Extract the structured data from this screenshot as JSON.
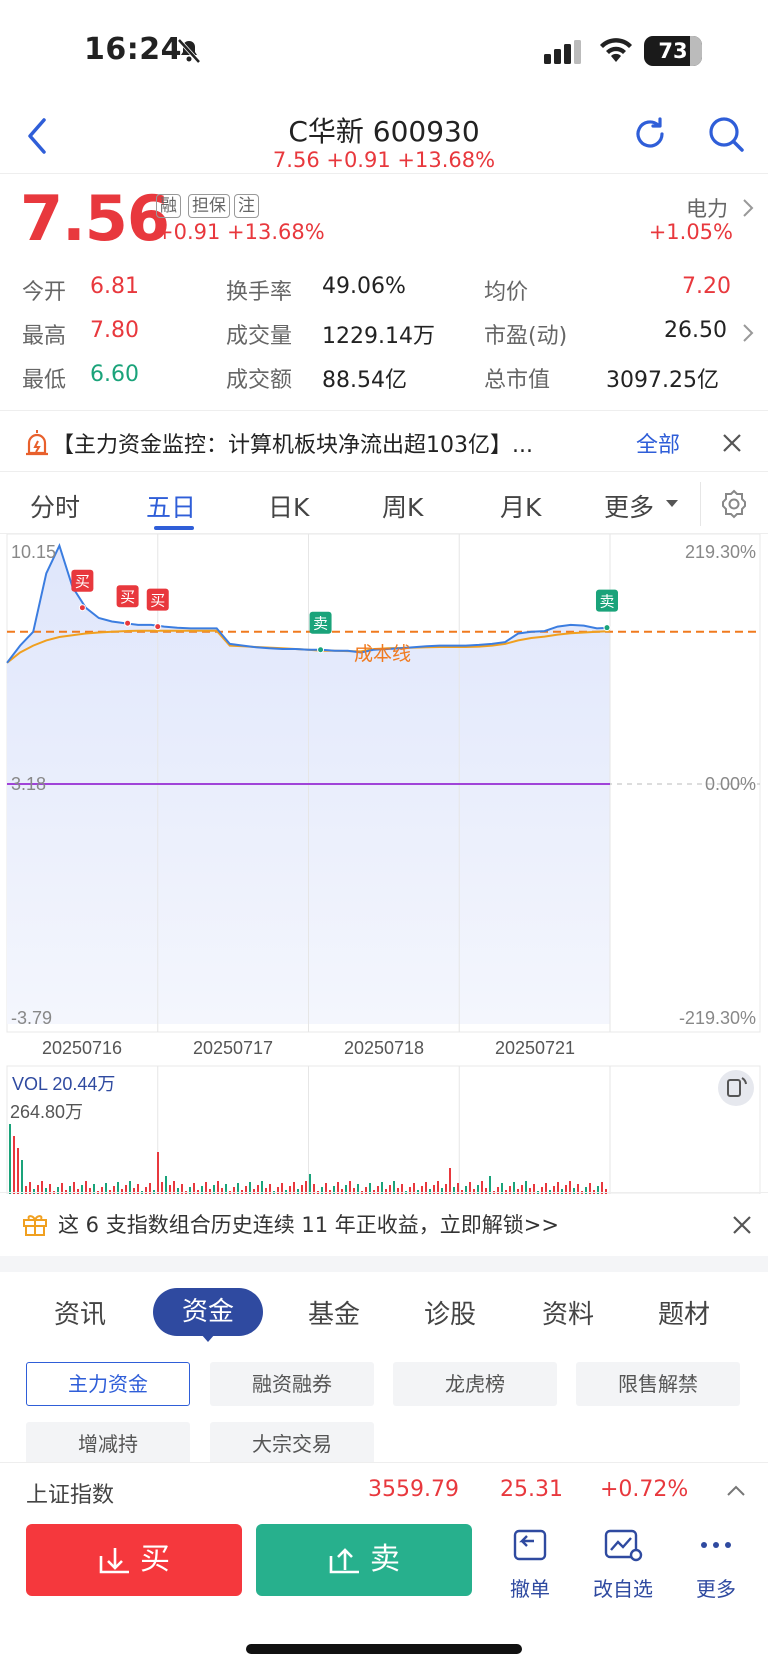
{
  "status_bar": {
    "time": "16:24",
    "battery": "73"
  },
  "header": {
    "title": "C华新 600930",
    "subtitle": "7.56 +0.91 +13.68%"
  },
  "quote": {
    "price": "7.56",
    "tags": [
      "融",
      "担保",
      "注"
    ],
    "change": "+0.91  +13.68%",
    "sector_name": "电力",
    "sector_change": "+1.05%"
  },
  "stats": [
    {
      "label": "今开",
      "value": "6.81",
      "color": "red"
    },
    {
      "label": "换手率",
      "value": "49.06%",
      "color": "black"
    },
    {
      "label": "均价",
      "value": "7.20",
      "color": "red"
    },
    {
      "label": "最高",
      "value": "7.80",
      "color": "red"
    },
    {
      "label": "成交量",
      "value": "1229.14万",
      "color": "black"
    },
    {
      "label": "市盈(动)",
      "value": "26.50",
      "color": "black"
    },
    {
      "label": "最低",
      "value": "6.60",
      "color": "green"
    },
    {
      "label": "成交额",
      "value": "88.54亿",
      "color": "black"
    },
    {
      "label": "总市值",
      "value": "3097.25亿",
      "color": "black"
    }
  ],
  "alert": {
    "text": "【主力资金监控：计算机板块净流出超103亿】...",
    "all_label": "全部"
  },
  "chart_tabs": [
    "分时",
    "五日",
    "日K",
    "周K",
    "月K",
    "更多"
  ],
  "chart_tab_active": "五日",
  "chart_data": {
    "type": "line",
    "y_left": {
      "top": "10.15",
      "mid": "3.18",
      "bottom": "-3.79"
    },
    "y_right": {
      "top": "219.30%",
      "mid": "0.00%",
      "bottom": "-219.30%"
    },
    "dates": [
      "20250716",
      "20250717",
      "20250718",
      "20250721"
    ],
    "cost_line_label": "成本线",
    "markers": [
      {
        "label": "买",
        "day": 0,
        "pos": 0.5
      },
      {
        "label": "买",
        "day": 0,
        "pos": 0.8
      },
      {
        "label": "买",
        "day": 1,
        "pos": 0.0
      },
      {
        "label": "卖",
        "day": 2,
        "pos": 0.08
      },
      {
        "label": "卖",
        "day": 3,
        "pos": 0.98
      }
    ],
    "price_series": [
      6.7,
      7.2,
      7.6,
      9.3,
      10.1,
      8.9,
      8.3,
      8.0,
      7.9,
      7.85,
      7.8,
      7.8,
      7.75,
      7.72,
      7.7,
      7.7,
      7.7,
      7.25,
      7.2,
      7.15,
      7.12,
      7.1,
      7.1,
      7.08,
      7.08,
      7.05,
      7.05,
      7.0,
      7.08,
      7.1,
      7.12,
      7.15,
      7.18,
      7.2,
      7.2,
      7.2,
      7.22,
      7.25,
      7.3,
      7.55,
      7.6,
      7.62,
      7.75,
      7.8,
      7.78,
      7.7,
      7.72
    ],
    "avg_series": [
      6.7,
      7.0,
      7.2,
      7.35,
      7.45,
      7.5,
      7.55,
      7.58,
      7.6,
      7.62,
      7.63,
      7.63,
      7.63,
      7.63,
      7.63,
      7.63,
      7.63,
      7.2,
      7.18,
      7.16,
      7.14,
      7.12,
      7.1,
      7.08,
      7.05,
      7.05,
      7.04,
      7.03,
      7.1,
      7.12,
      7.13,
      7.14,
      7.15,
      7.16,
      7.16,
      7.16,
      7.17,
      7.2,
      7.25,
      7.35,
      7.42,
      7.46,
      7.52,
      7.56,
      7.58,
      7.6,
      7.62
    ],
    "cost_line": 7.6,
    "vol_label": "VOL 20.44万",
    "vol_max": "264.80万"
  },
  "promo": {
    "text": "这 6 支指数组合历史连续 11 年正收益，立即解锁>>"
  },
  "sub_tabs": [
    "资讯",
    "资金",
    "基金",
    "诊股",
    "资料",
    "题材"
  ],
  "sub_tab_active": "资金",
  "chips": [
    "主力资金",
    "融资融券",
    "龙虎榜",
    "限售解禁",
    "增减持",
    "大宗交易"
  ],
  "index_bar": {
    "name": "上证指数",
    "value": "3559.79",
    "change": "25.31",
    "pct": "+0.72%"
  },
  "bottom": {
    "buy": "买",
    "sell": "卖",
    "cancel": "撤单",
    "watch": "改自选",
    "more": "更多"
  }
}
